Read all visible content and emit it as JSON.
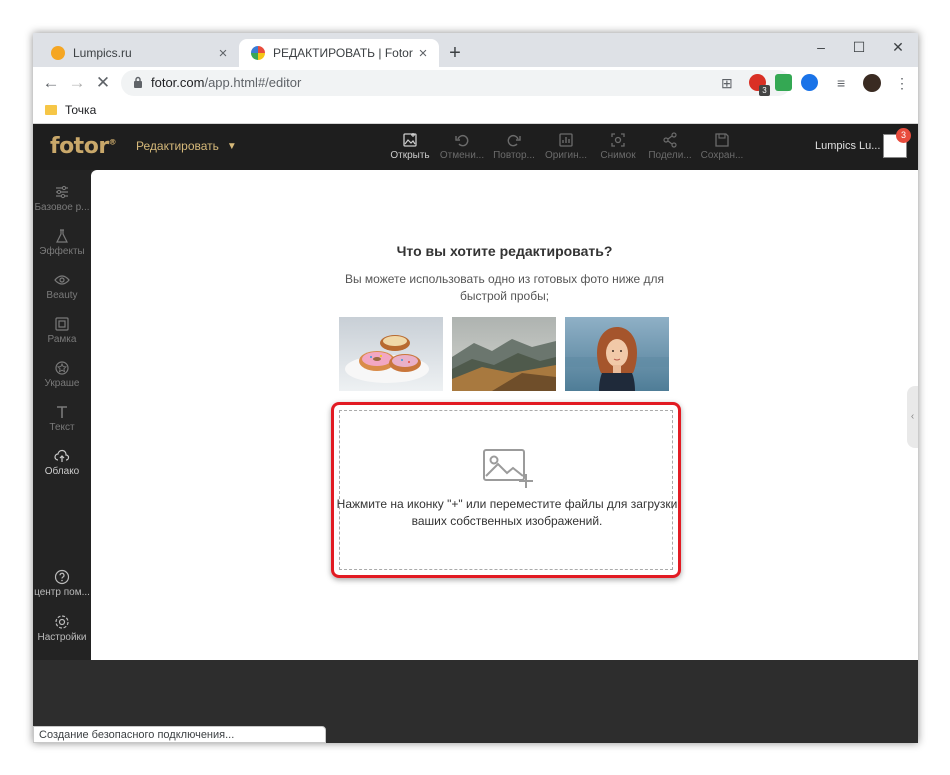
{
  "browser": {
    "tabs": [
      {
        "title": "Lumpics.ru",
        "close": "×"
      },
      {
        "title": "РЕДАКТИРОВАТЬ | Fotor",
        "close": "×"
      }
    ],
    "new_tab": "+",
    "window_controls": {
      "minimize": "–",
      "maximize": "☐",
      "close": "✕"
    },
    "url_host": "fotor.com",
    "url_path": "/app.html#/editor",
    "bookmarks": [
      {
        "label": "Точка"
      }
    ],
    "extension_badge": "3",
    "status_text": "Создание безопасного подключения..."
  },
  "app": {
    "logo": "fotor",
    "logo_mark": "®",
    "edit_menu": "Редактировать",
    "tools": [
      {
        "label": "Открыть",
        "icon": "image-open-icon"
      },
      {
        "label": "Отмени...",
        "icon": "undo-icon"
      },
      {
        "label": "Повтор...",
        "icon": "redo-icon"
      },
      {
        "label": "Оригин...",
        "icon": "original-icon"
      },
      {
        "label": "Снимок",
        "icon": "snapshot-icon"
      },
      {
        "label": "Подели...",
        "icon": "share-icon"
      },
      {
        "label": "Сохран...",
        "icon": "save-icon"
      }
    ],
    "user_name": "Lumpics Lu...",
    "notification_count": "3",
    "sidebar": [
      {
        "label": "Базовое р...",
        "icon": "sliders-icon"
      },
      {
        "label": "Эффекты",
        "icon": "flask-icon"
      },
      {
        "label": "Beauty",
        "icon": "eye-icon"
      },
      {
        "label": "Рамка",
        "icon": "frame-icon"
      },
      {
        "label": "Украше",
        "icon": "sticker-icon"
      },
      {
        "label": "Текст",
        "icon": "text-icon"
      },
      {
        "label": "Облако",
        "icon": "cloud-icon"
      }
    ],
    "sidebar_bottom": [
      {
        "label": "центр пом...",
        "icon": "help-icon"
      },
      {
        "label": "Настройки",
        "icon": "settings-icon"
      }
    ]
  },
  "main": {
    "heading": "Что вы хотите редактировать?",
    "subtext": "Вы можете использовать одно из готовых фото ниже для быстрой пробы;",
    "samples": [
      "donuts",
      "mountains",
      "portrait"
    ],
    "drop_text": "Нажмите на иконку \"+\" или переместите файлы для загрузки ваших собственных изображений."
  },
  "colors": {
    "accent": "#c9a86a",
    "highlight": "#e21b23",
    "badge": "#e84c3d"
  }
}
